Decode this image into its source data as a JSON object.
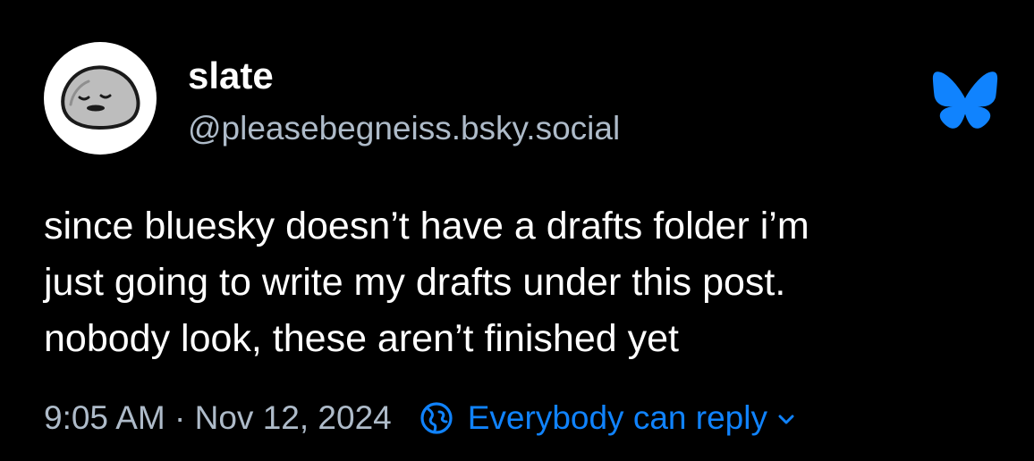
{
  "author": {
    "display_name": "slate",
    "handle": "@pleasebegneiss.bsky.social",
    "avatar_icon": "rock-with-face-avatar"
  },
  "brand": {
    "icon": "bluesky-butterfly-icon",
    "color": "#1083fe"
  },
  "post": {
    "lines": [
      "since bluesky doesn’t have a drafts folder i’m",
      "just going to write my drafts under this post.",
      "nobody look, these aren’t finished yet"
    ]
  },
  "footer": {
    "timestamp": "9:05 AM · Nov 12, 2024",
    "reply_setting_icon": "globe-icon",
    "reply_setting_label": "Everybody can reply",
    "dropdown_icon": "chevron-down-icon"
  },
  "colors": {
    "background": "#000000",
    "text": "#ffffff",
    "muted": "#aebbc9",
    "accent": "#1083fe"
  }
}
